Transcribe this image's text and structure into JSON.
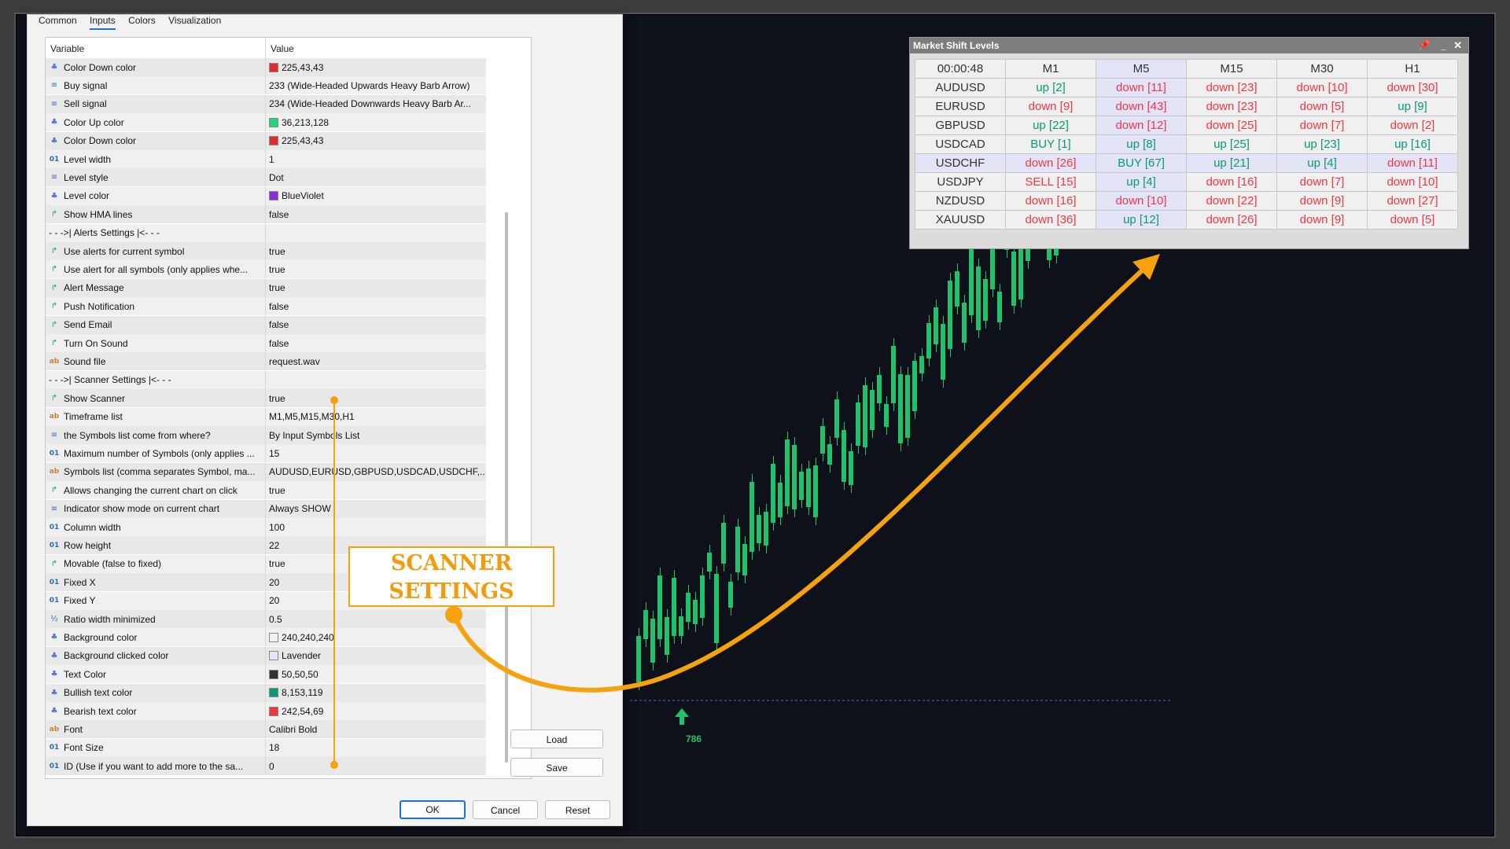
{
  "dialog": {
    "tabs": [
      "Common",
      "Inputs",
      "Colors",
      "Visualization"
    ],
    "active_tab": "Inputs",
    "columns": {
      "variable": "Variable",
      "value": "Value"
    },
    "rows": [
      {
        "icon": "color",
        "name": "Color Down color",
        "value": "225,43,43",
        "swatch": "#e12b2b"
      },
      {
        "icon": "enum",
        "name": "Buy signal",
        "value": "233 (Wide-Headed Upwards Heavy Barb Arrow)"
      },
      {
        "icon": "enum",
        "name": "Sell signal",
        "value": "234 (Wide-Headed Downwards Heavy Barb Ar..."
      },
      {
        "icon": "color",
        "name": "Color Up color",
        "value": "36,213,128",
        "swatch": "#24d580"
      },
      {
        "icon": "color",
        "name": "Color Down color",
        "value": "225,43,43",
        "swatch": "#e12b2b"
      },
      {
        "icon": "num",
        "name": "Level width",
        "value": "1"
      },
      {
        "icon": "enum",
        "name": "Level style",
        "value": "Dot"
      },
      {
        "icon": "color",
        "name": "Level color",
        "value": "BlueViolet",
        "swatch": "#8a2be2"
      },
      {
        "icon": "bool",
        "name": "Show HMA lines",
        "value": "false"
      },
      {
        "icon": "none",
        "name": "- - ->| Alerts Settings |<- - -",
        "value": ""
      },
      {
        "icon": "bool",
        "name": "Use alerts for current symbol",
        "value": "true"
      },
      {
        "icon": "bool",
        "name": "Use alert for all symbols (only applies whe...",
        "value": "true"
      },
      {
        "icon": "bool",
        "name": "Alert Message",
        "value": "true"
      },
      {
        "icon": "bool",
        "name": "Push Notification",
        "value": "false"
      },
      {
        "icon": "bool",
        "name": "Send Email",
        "value": "false"
      },
      {
        "icon": "bool",
        "name": "Turn On Sound",
        "value": "false"
      },
      {
        "icon": "str",
        "name": "Sound file",
        "value": "request.wav"
      },
      {
        "icon": "none",
        "name": "- - ->| Scanner Settings |<- - -",
        "value": ""
      },
      {
        "icon": "bool",
        "name": "Show Scanner",
        "value": "true"
      },
      {
        "icon": "str",
        "name": "Timeframe list",
        "value": "M1,M5,M15,M30,H1"
      },
      {
        "icon": "enum",
        "name": "the Symbols list come from where?",
        "value": "By Input Symbols List"
      },
      {
        "icon": "num",
        "name": "Maximum number of Symbols (only applies ...",
        "value": "15"
      },
      {
        "icon": "str",
        "name": "Symbols list (comma separates Symbol, ma...",
        "value": "AUDUSD,EURUSD,GBPUSD,USDCAD,USDCHF,..."
      },
      {
        "icon": "bool",
        "name": "Allows changing the current chart on click",
        "value": "true"
      },
      {
        "icon": "enum",
        "name": "Indicator show mode on current chart",
        "value": "Always SHOW"
      },
      {
        "icon": "num",
        "name": "Column width",
        "value": "100"
      },
      {
        "icon": "num",
        "name": "Row height",
        "value": "22"
      },
      {
        "icon": "bool",
        "name": "Movable (false to fixed)",
        "value": "true"
      },
      {
        "icon": "num",
        "name": "Fixed X",
        "value": "20"
      },
      {
        "icon": "num",
        "name": "Fixed Y",
        "value": "20"
      },
      {
        "icon": "frac",
        "name": "Ratio width minimized",
        "value": "0.5"
      },
      {
        "icon": "color",
        "name": "Background color",
        "value": "240,240,240",
        "swatch": "#f0f0f0"
      },
      {
        "icon": "color",
        "name": "Background clicked color",
        "value": "Lavender",
        "swatch": "#e6e6fa"
      },
      {
        "icon": "color",
        "name": "Text Color",
        "value": "50,50,50",
        "swatch": "#323232"
      },
      {
        "icon": "color",
        "name": "Bullish text color",
        "value": "8,153,119",
        "swatch": "#089977"
      },
      {
        "icon": "color",
        "name": "Bearish text color",
        "value": "242,54,69",
        "swatch": "#f23645"
      },
      {
        "icon": "str",
        "name": "Font",
        "value": "Calibri Bold"
      },
      {
        "icon": "num",
        "name": "Font Size",
        "value": "18"
      },
      {
        "icon": "num",
        "name": "ID (Use if you want to add more to the sa...",
        "value": "0"
      }
    ],
    "side_buttons": {
      "load": "Load",
      "save": "Save"
    },
    "footer_buttons": {
      "ok": "OK",
      "cancel": "Cancel",
      "reset": "Reset"
    }
  },
  "scanner": {
    "title": "Market Shift Levels",
    "timer": "00:00:48",
    "timeframes": [
      "M1",
      "M5",
      "M15",
      "M30",
      "H1"
    ],
    "highlight_column": "M5",
    "highlight_row": "USDCHF",
    "rows": [
      {
        "symbol": "AUDUSD",
        "cells": [
          [
            "up [2]",
            "bull"
          ],
          [
            "down [11]",
            "bear"
          ],
          [
            "down [23]",
            "bear"
          ],
          [
            "down [10]",
            "bear"
          ],
          [
            "down [30]",
            "bear"
          ]
        ]
      },
      {
        "symbol": "EURUSD",
        "cells": [
          [
            "down [9]",
            "bear"
          ],
          [
            "down [43]",
            "bear"
          ],
          [
            "down [23]",
            "bear"
          ],
          [
            "down [5]",
            "bear"
          ],
          [
            "up [9]",
            "bull"
          ]
        ]
      },
      {
        "symbol": "GBPUSD",
        "cells": [
          [
            "up [22]",
            "bull"
          ],
          [
            "down [12]",
            "bear"
          ],
          [
            "down [25]",
            "bear"
          ],
          [
            "down [7]",
            "bear"
          ],
          [
            "down [2]",
            "bear"
          ]
        ]
      },
      {
        "symbol": "USDCAD",
        "cells": [
          [
            "BUY [1]",
            "bull"
          ],
          [
            "up [8]",
            "bull"
          ],
          [
            "up [25]",
            "bull"
          ],
          [
            "up [23]",
            "bull"
          ],
          [
            "up [16]",
            "bull"
          ]
        ]
      },
      {
        "symbol": "USDCHF",
        "cells": [
          [
            "down [26]",
            "bear"
          ],
          [
            "BUY [67]",
            "bull"
          ],
          [
            "up [21]",
            "bull"
          ],
          [
            "up [4]",
            "bull"
          ],
          [
            "down [11]",
            "bear"
          ]
        ]
      },
      {
        "symbol": "USDJPY",
        "cells": [
          [
            "SELL [15]",
            "bear"
          ],
          [
            "up [4]",
            "bull"
          ],
          [
            "down [16]",
            "bear"
          ],
          [
            "down [7]",
            "bear"
          ],
          [
            "down [10]",
            "bear"
          ]
        ]
      },
      {
        "symbol": "NZDUSD",
        "cells": [
          [
            "down [16]",
            "bear"
          ],
          [
            "down [10]",
            "bear"
          ],
          [
            "down [22]",
            "bear"
          ],
          [
            "down [9]",
            "bear"
          ],
          [
            "down [27]",
            "bear"
          ]
        ]
      },
      {
        "symbol": "XAUUSD",
        "cells": [
          [
            "down [36]",
            "bear"
          ],
          [
            "up [12]",
            "bull"
          ],
          [
            "down [26]",
            "bear"
          ],
          [
            "down [9]",
            "bear"
          ],
          [
            "down [5]",
            "bear"
          ]
        ]
      }
    ]
  },
  "annotation": {
    "line1": "SCANNER",
    "line2": "SETTINGS"
  },
  "chart": {
    "signal_label": "786"
  },
  "colors": {
    "bullish": "#089977",
    "bearish": "#f23645",
    "accent": "#f5a20d",
    "candle": "#1fc26a"
  }
}
